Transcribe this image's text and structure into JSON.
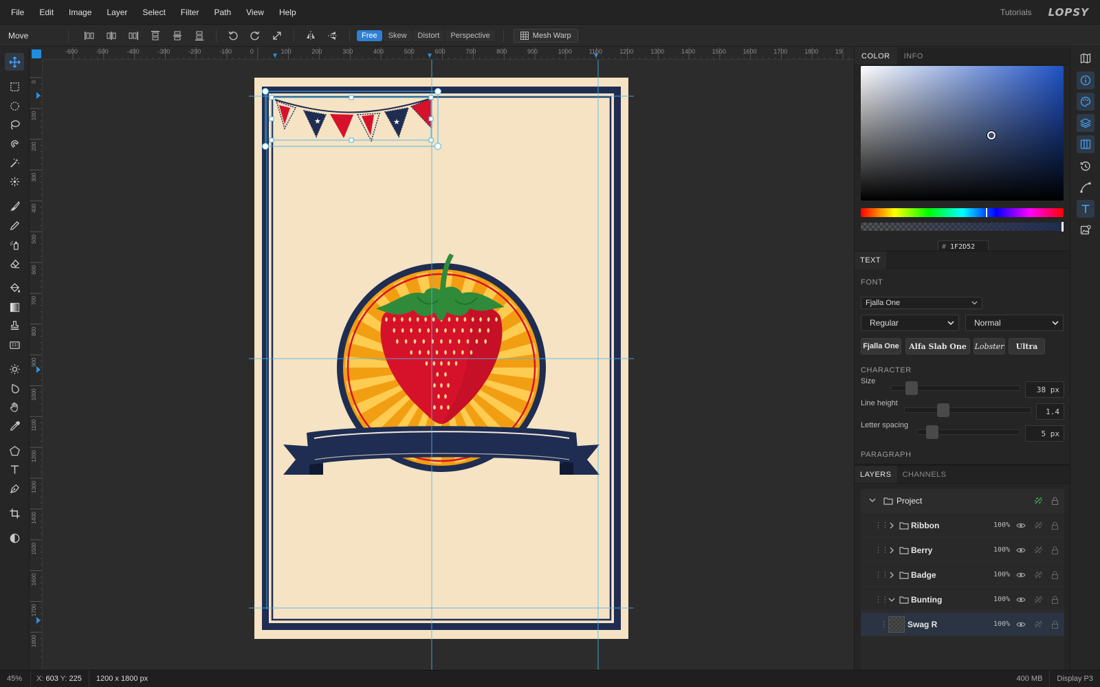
{
  "menu": {
    "items": [
      "File",
      "Edit",
      "Image",
      "Layer",
      "Select",
      "Filter",
      "Path",
      "View",
      "Help"
    ],
    "tutorials": "Tutorials",
    "logo": "LOPSY"
  },
  "options": {
    "tool_name": "Move",
    "transform_modes": [
      "Free",
      "Skew",
      "Distort",
      "Perspective"
    ],
    "active_mode": "Free",
    "mesh_warp": "Mesh Warp"
  },
  "rulers": {
    "h_labels": [
      "-600",
      "-500",
      "-400",
      "-300",
      "-200",
      "-100",
      "0",
      "100",
      "200",
      "300",
      "400",
      "500",
      "600",
      "700",
      "800",
      "900",
      "1000",
      "1100",
      "1200",
      "1300",
      "1400",
      "1500",
      "1600",
      "1700",
      "1800",
      "19"
    ],
    "v_labels": [
      "0",
      "100",
      "200",
      "300",
      "400",
      "500",
      "600",
      "700",
      "800",
      "900",
      "1000",
      "1100",
      "1200",
      "1300",
      "1400",
      "1500",
      "1600",
      "1700",
      "1800"
    ]
  },
  "tools": [
    "move-tool",
    "rect-select-tool",
    "ellipse-select-tool",
    "lasso-tool",
    "magnetic-lasso-tool",
    "magic-wand-tool",
    "quick-select-tool",
    "brush-tool",
    "pencil-tool",
    "spray-tool",
    "eraser-tool",
    "fill-tool",
    "gradient-tool",
    "stamp-tool",
    "pattern-tool",
    "dodge-tool",
    "blur-tool",
    "hand-tool",
    "eyedropper-tool",
    "polygon-tool",
    "text-tool",
    "pen-tool",
    "crop-tool",
    "contrast-tool"
  ],
  "color_panel": {
    "tabs": [
      "COLOR",
      "INFO"
    ],
    "active_tab": "COLOR",
    "hex_prefix": "#",
    "hex": "1F2D52",
    "base_hue_color": "#1f52c6",
    "selected_color": "#1F2D52",
    "hue_level": 0.62
  },
  "text_panel": {
    "tab": "TEXT",
    "font_label": "FONT",
    "font_value": "Fjalla One",
    "weight": "Regular",
    "style": "Normal",
    "font_chips": [
      "Fjalla One",
      "Alfa Slab One",
      "Lobster",
      "Ultra"
    ],
    "character_label": "CHARACTER",
    "size": {
      "label": "Size",
      "value": "38 px",
      "level": 0.12
    },
    "line_height": {
      "label": "Line height",
      "value": "1.4",
      "level": 0.28
    },
    "letter_spacing": {
      "label": "Letter spacing",
      "value": "5 px",
      "level": 0.1
    },
    "paragraph_label": "PARAGRAPH"
  },
  "layers_panel": {
    "tabs": [
      "LAYERS",
      "CHANNELS"
    ],
    "active_tab": "LAYERS",
    "project": "Project",
    "layers": [
      {
        "name": "Ribbon",
        "opacity": "100%"
      },
      {
        "name": "Berry",
        "opacity": "100%"
      },
      {
        "name": "Badge",
        "opacity": "100%"
      },
      {
        "name": "Bunting",
        "opacity": "100%"
      },
      {
        "name": "Swag R",
        "opacity": "100%"
      }
    ]
  },
  "status": {
    "zoom": "45%",
    "x_label": "X:",
    "x": "603",
    "y_label": "Y:",
    "y": "225",
    "doc_size": "1200 x 1800 px",
    "memory": "400 MB",
    "profile": "Display P3"
  },
  "colors": {
    "accent": "#2e80d4",
    "poster_bg": "#f5e3c4",
    "navy": "#1f2d52",
    "red": "#d6122b",
    "orange": "#f4a11c",
    "green": "#2f8a3a"
  }
}
